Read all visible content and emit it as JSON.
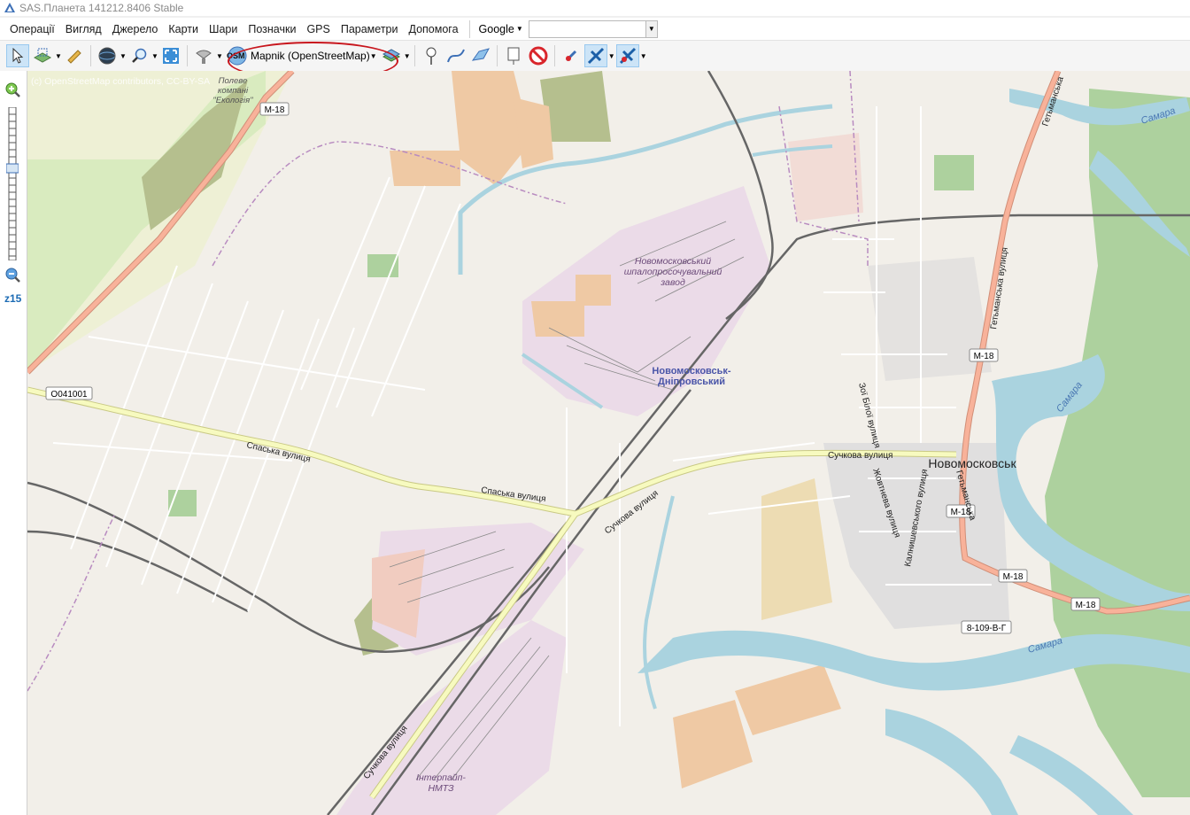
{
  "window": {
    "title": "SAS.Планета 141212.8406 Stable"
  },
  "menu": [
    "Операції",
    "Вигляд",
    "Джерело",
    "Карти",
    "Шари",
    "Позначки",
    "GPS",
    "Параметри",
    "Допомога"
  ],
  "search": {
    "provider": "Google",
    "value": ""
  },
  "toolbar": {
    "map_source": "Mapnik (OpenStreetMap)",
    "map_badge": "OSM"
  },
  "zoom": {
    "level": "z15"
  },
  "map": {
    "attribution": "(c) OpenStreetMap contributors, CC-BY-SA",
    "labels": {
      "area_ecology": "Полеве\nкомпані\n\"Екологія\"",
      "road_m18_1": "M-18",
      "road_m18_2": "M-18",
      "road_m18_3": "M-18",
      "road_m18_4": "M-18",
      "road_m18_5": "M-18",
      "road_o041001": "O041001",
      "road_8109": "8-109-В-Г",
      "spaska_1": "Спаська вулиця",
      "spaska_2": "Спаська вулиця",
      "sunkova_1": "Сучкова вулиця",
      "sunkova_2": "Сучкова вулиця",
      "sunkova_3": "Сучкова вулиця",
      "plant_1": "Новомосковський",
      "plant_2": "шпалопросочувальний",
      "plant_3": "завод",
      "station_1": "Новомосковськ-",
      "station_2": "Дніпровський",
      "city": "Новомосковськ",
      "getmanska_1": "Гетьманська вулиця",
      "getmanska_2": "Гетьманська",
      "getmanska_3": "Гетьманська",
      "zoi": "Зої Білої вулиця",
      "zhovtneva": "Жовтнева вулиця",
      "kalnysh": "Калнишевського вулиця",
      "samara_1": "Самара",
      "samara_2": "Самара",
      "samara_3": "Самара",
      "interpipe_1": "Інтерпайп-",
      "interpipe_2": "НМТЗ"
    }
  },
  "colors": {
    "water": "#aad3df",
    "forest": "#add19e",
    "primary_road": "#f8b29a",
    "secondary_road": "#f7fabf",
    "industrial": "#ebdbe8",
    "residential": "#e0dfdf",
    "farmland": "#eef0d5",
    "grass": "#cdebb0",
    "highlight_oval": "#c8161d",
    "zoom_text": "#1c6bb4"
  }
}
